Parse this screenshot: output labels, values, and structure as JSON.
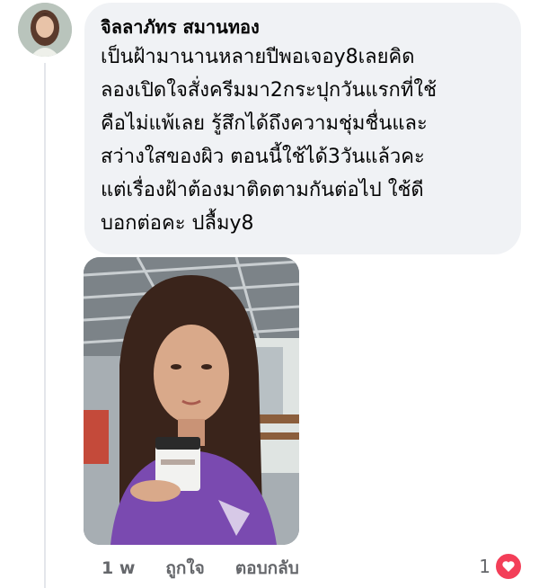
{
  "comment": {
    "author": "จิลลาภัทร สมานทอง",
    "text": "เป็นฝ้ามานานหลายปีพอเจอy8เลยคิด\nลองเปิดใจสั่งครีมมา2กระปุกวันแรกที่ใช้\nคือไม่แพ้เลย รู้สึกได้ถึงความชุ่มชื่นและ\nสว่างใสของผิว ตอนนี้ใช้ได้3วันแล้วคะ\nแต่เรื่องฝ้าต้องมาติดตามกันต่อไป ใช้ดี\nบอกต่อคะ ปลื้มy8",
    "time": "1 w",
    "like_label": "ถูกใจ",
    "reply_label": "ตอบกลับ",
    "reaction_count": "1",
    "reaction_icon": "heart-icon",
    "reaction_color": "#f33e58"
  }
}
